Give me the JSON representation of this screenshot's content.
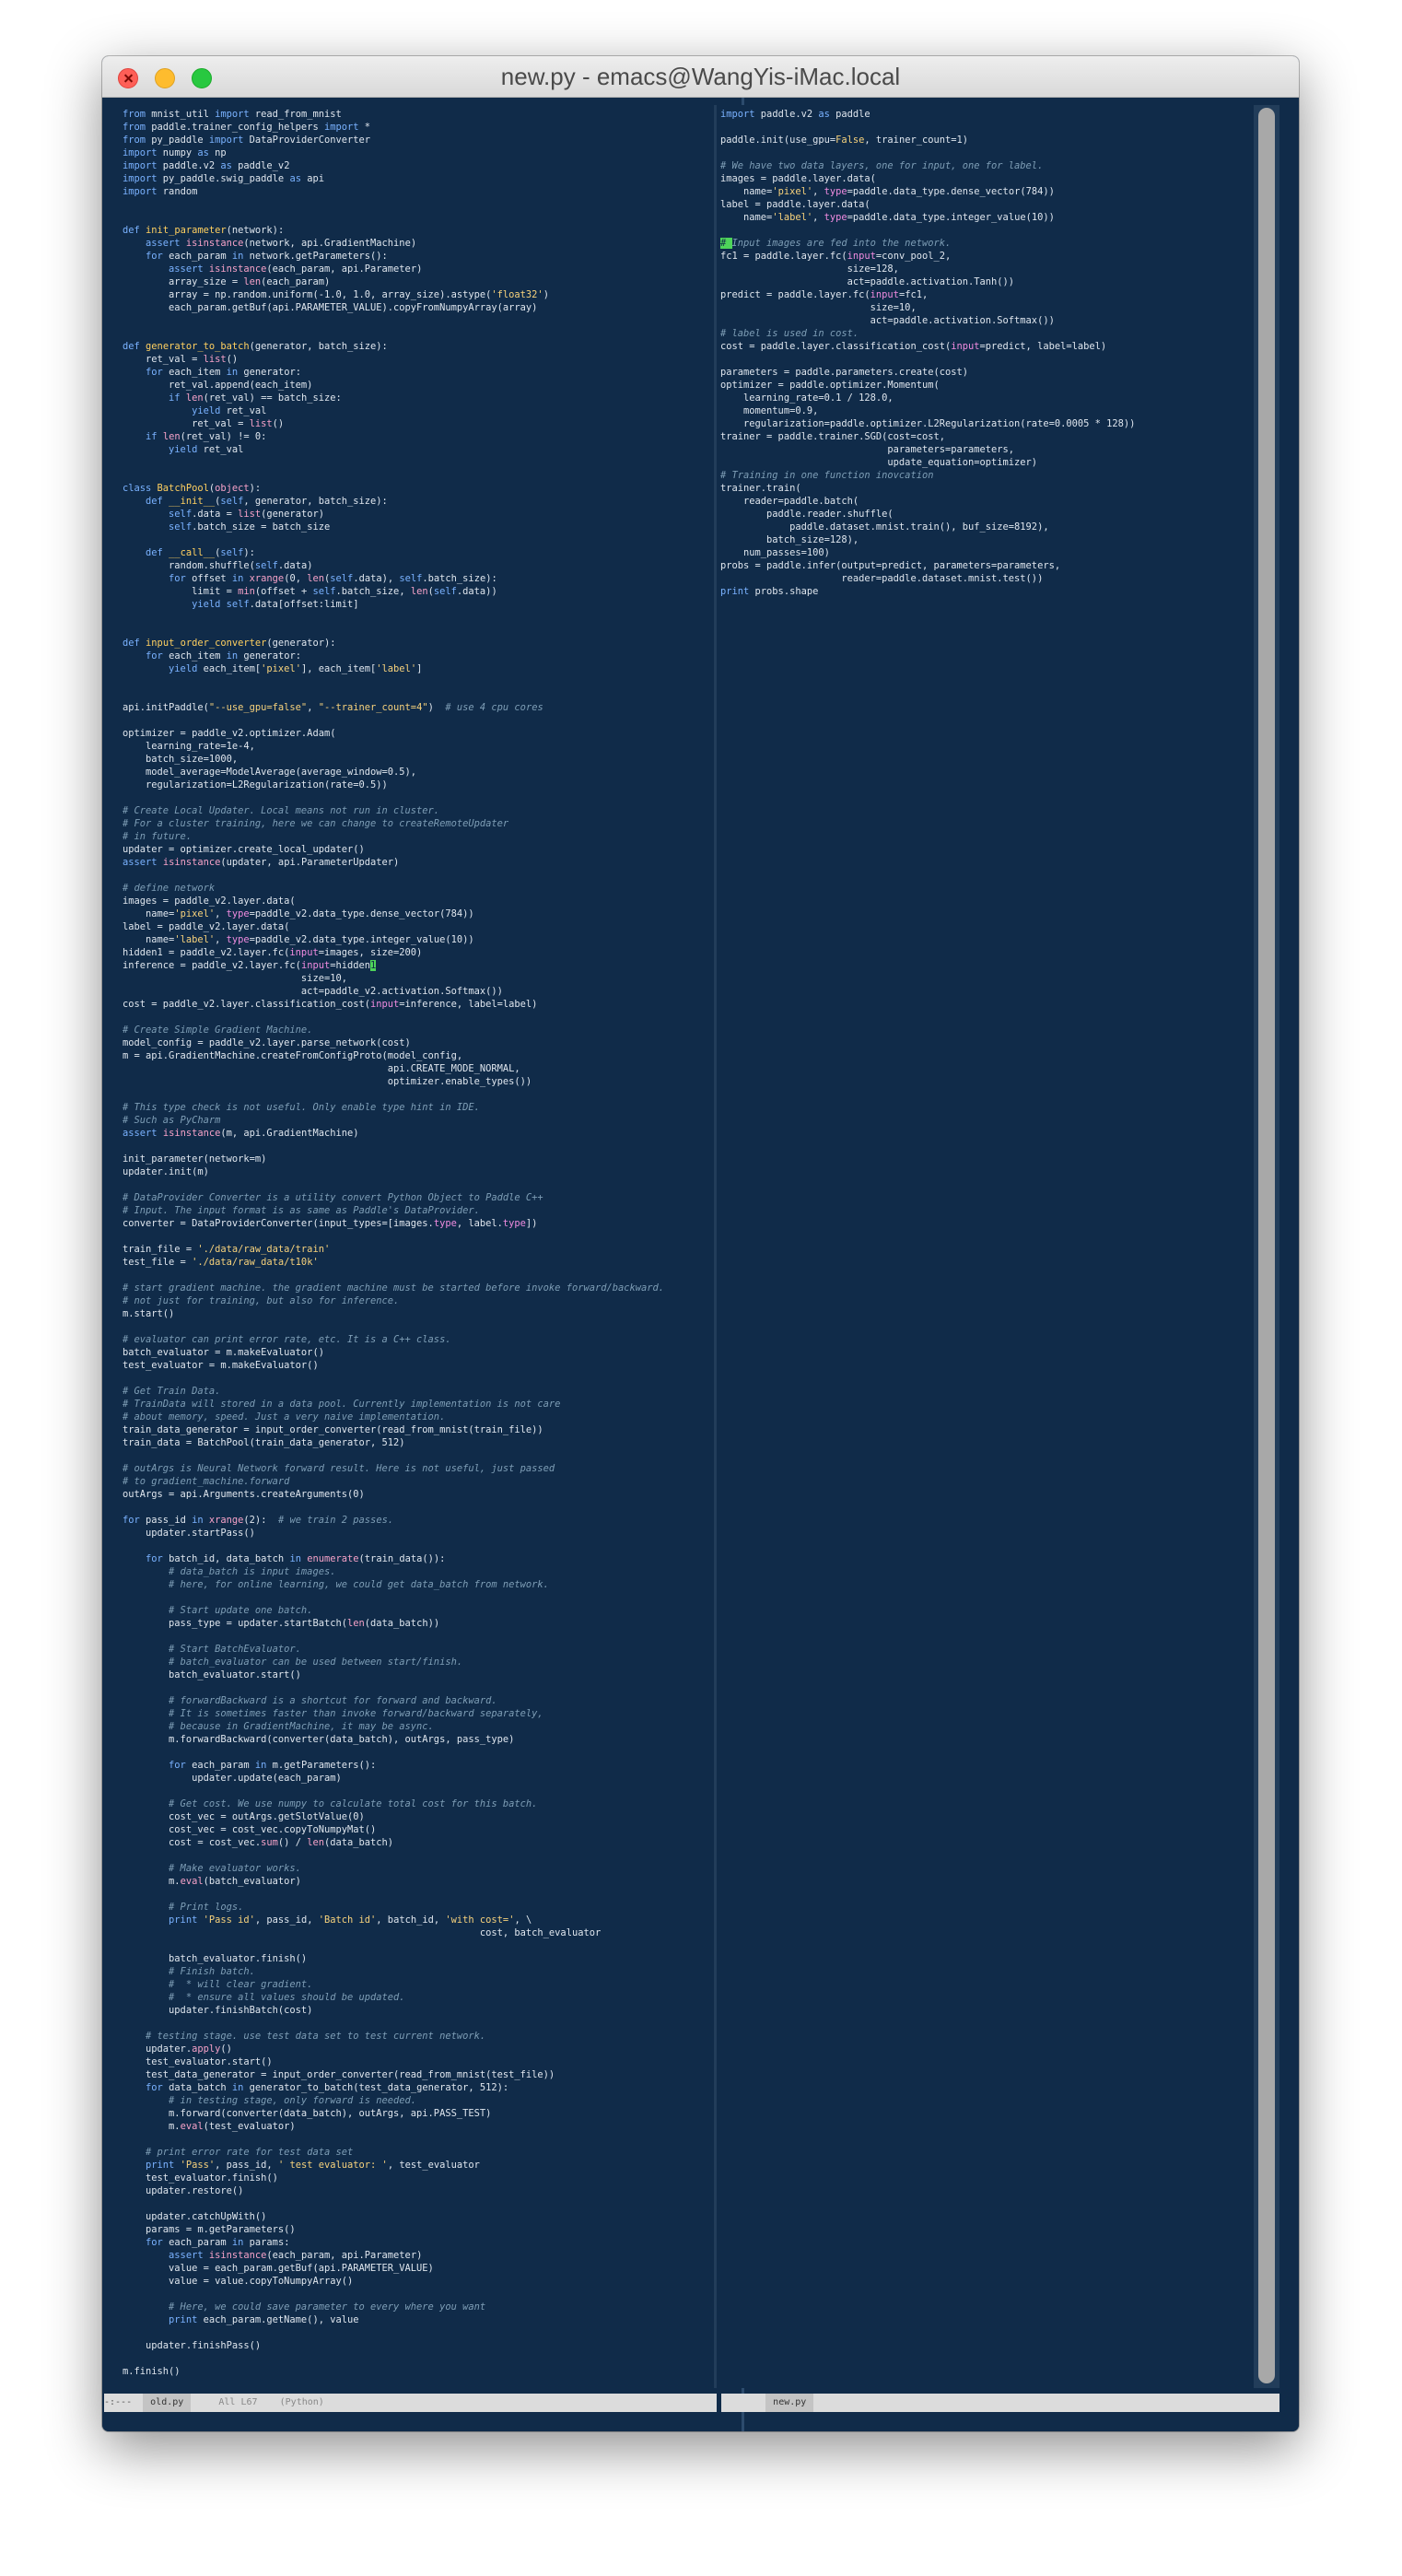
{
  "window": {
    "title": "new.py - emacs@WangYis-iMac.local"
  },
  "left_pane": {
    "buffer_name": "old.py",
    "modeline_prefix": "-:---",
    "position": "All L67",
    "mode": "(Python)"
  },
  "right_pane": {
    "buffer_name": "new.py"
  }
}
